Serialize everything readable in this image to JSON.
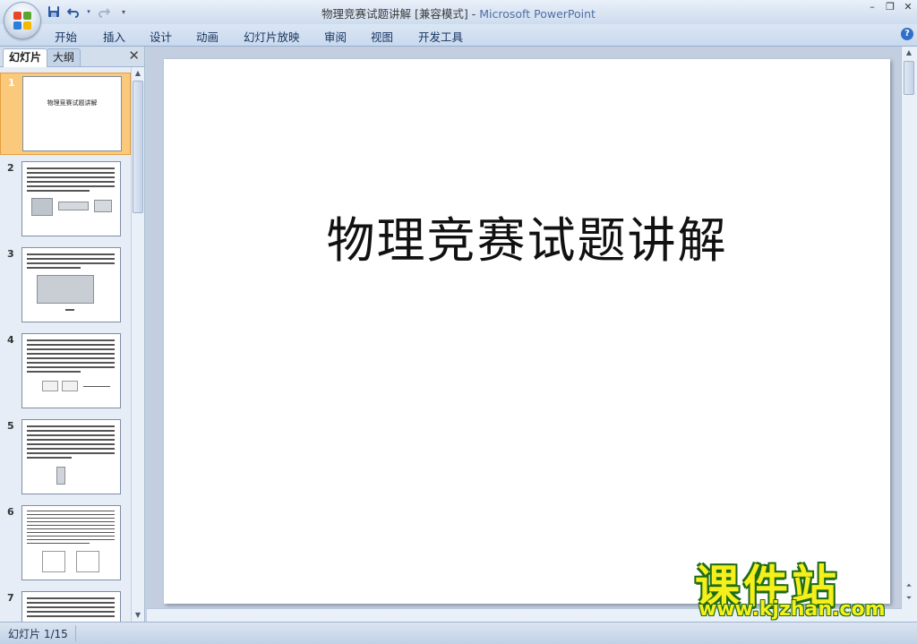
{
  "window": {
    "doc_title": "物理竞赛试题讲解 [兼容模式]",
    "separator": " - ",
    "app_name": "Microsoft PowerPoint"
  },
  "quick_access": {
    "save_icon": "save-icon",
    "undo_icon": "undo-icon",
    "redo_icon": "redo-icon",
    "customize_icon": "customize-icon"
  },
  "ribbon": {
    "tabs": [
      "开始",
      "插入",
      "设计",
      "动画",
      "幻灯片放映",
      "审阅",
      "视图",
      "开发工具"
    ]
  },
  "left_pane": {
    "tab_slides": "幻灯片",
    "tab_outline": "大纲",
    "close_glyph": "✕",
    "thumbnails": [
      {
        "num": "1",
        "title": "物理竞赛试题讲解"
      },
      {
        "num": "2"
      },
      {
        "num": "3"
      },
      {
        "num": "4"
      },
      {
        "num": "5"
      },
      {
        "num": "6"
      },
      {
        "num": "7"
      }
    ]
  },
  "slide": {
    "title": "物理竞赛试题讲解"
  },
  "status_bar": {
    "slide_indicator": "幻灯片 1/15"
  },
  "watermark": {
    "cn": "课件站",
    "url": "www.kjzhan.com"
  },
  "colors": {
    "selected_thumb_bg": "#fbc97c",
    "selected_thumb_border": "#e59f3f",
    "app_title_blue": "#4e6fa4",
    "watermark_yellow": "#f5ef1b",
    "watermark_green": "#1f6b16"
  }
}
